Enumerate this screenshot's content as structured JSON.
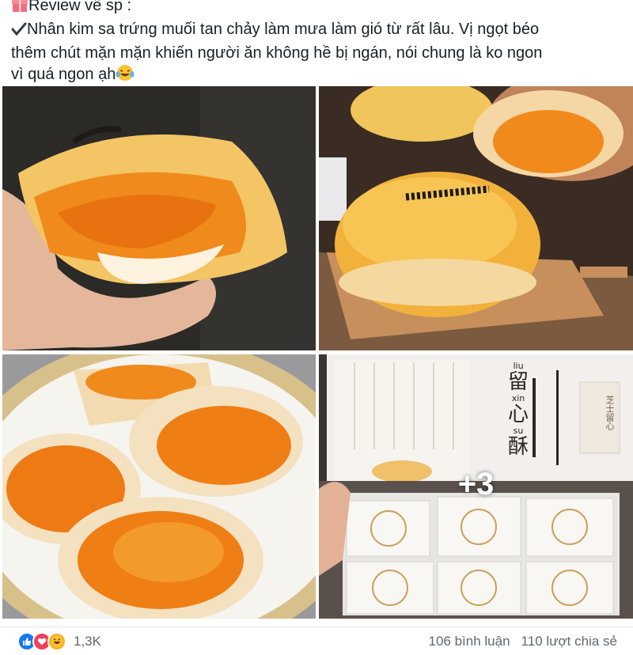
{
  "post": {
    "heading_line": "Review về sp :",
    "body_line_1": "Nhân kim sa trứng muối tan chảy làm mưa làm gió từ rất lâu. Vị ngọt béo",
    "body_line_2": "thêm chút mặn mặn khiến người ăn không hề bị ngán, nói chung là ko ngon",
    "body_line_3": "vì quá ngon ạh",
    "icons": [
      "gift-icon",
      "checkmark-icon",
      "laughing-tears-emoji"
    ]
  },
  "photos": {
    "more_label": "+3",
    "box_text": {
      "pinyin_1": "liu",
      "char_1": "留",
      "pinyin_2": "xin",
      "char_2": "心",
      "pinyin_3": "su",
      "char_3": "酥",
      "seal": "芝士留心"
    }
  },
  "footer": {
    "reaction_count": "1,3K",
    "comments": "106 bình luận",
    "shares": "110 lượt chia sẻ",
    "reaction_icons": [
      "like-icon",
      "love-icon",
      "haha-icon"
    ]
  },
  "colors": {
    "like": "#1877f2",
    "love": "#f33e58",
    "haha": "#f7b125",
    "meta_text": "#65676b"
  }
}
